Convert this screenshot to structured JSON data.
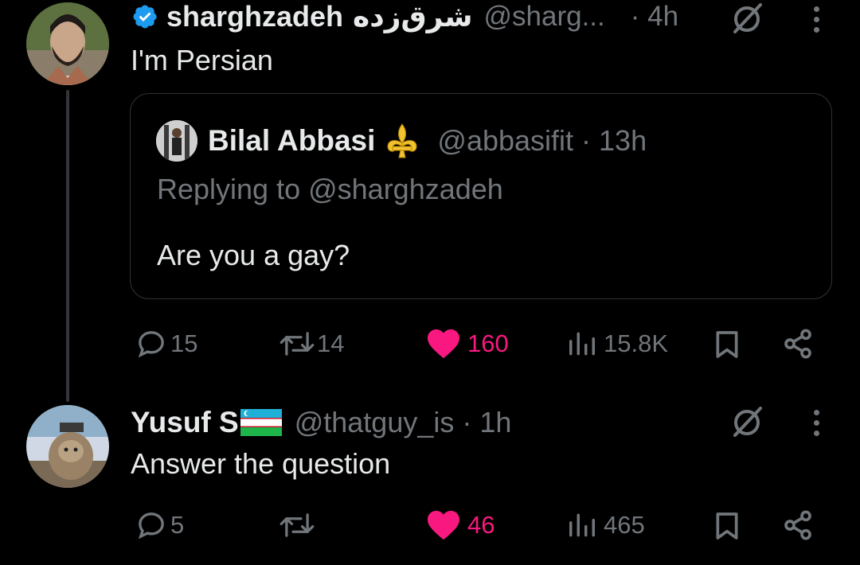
{
  "tweet1": {
    "display_name": "sharghzadeh",
    "rtl_name": "شرق‌زده",
    "handle": "@sharg...",
    "time": "· 4h",
    "text": "I'm Persian",
    "actions": {
      "replies": "15",
      "reposts": "14",
      "likes": "160",
      "views": "15.8K"
    }
  },
  "quote": {
    "display_name": "Bilal Abbasi",
    "handle": "@abbasifit",
    "time": "· 13h",
    "replying_to": "Replying to @sharghzadeh",
    "text": "Are you a gay?"
  },
  "tweet2": {
    "display_name": "Yusuf S",
    "handle": "@thatguy_is",
    "time": "· 1h",
    "text": "Answer the question",
    "actions": {
      "replies": "5",
      "reposts": "",
      "likes": "46",
      "views": "465"
    }
  },
  "colors": {
    "background": "#000000",
    "text": "#e7e9ea",
    "muted": "#71767b",
    "like": "#f91880",
    "verified": "#1d9bf0"
  },
  "icons": [
    "verified-badge-icon",
    "grok-icon",
    "more-icon",
    "reply-icon",
    "repost-icon",
    "like-icon",
    "views-icon",
    "bookmark-icon",
    "share-icon",
    "fleur-de-lis-icon",
    "uzbekistan-flag-icon"
  ]
}
